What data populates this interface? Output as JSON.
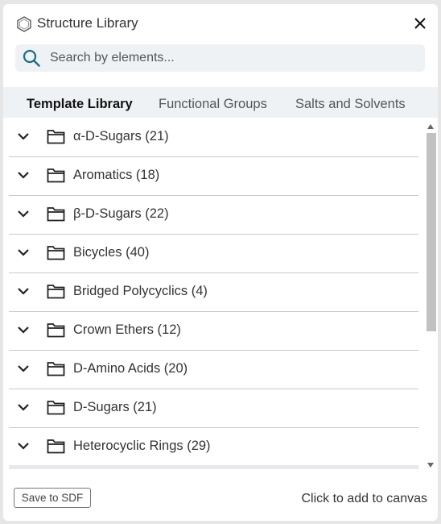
{
  "header": {
    "title": "Structure Library",
    "logo_icon": "hexagon-icon",
    "close_icon": "close-icon"
  },
  "search": {
    "placeholder": "Search by elements...",
    "value": ""
  },
  "tabs": [
    {
      "label": "Template Library",
      "active": true
    },
    {
      "label": "Functional Groups",
      "active": false
    },
    {
      "label": "Salts and Solvents",
      "active": false
    }
  ],
  "groups": [
    {
      "label": "α-D-Sugars (21)"
    },
    {
      "label": "Aromatics (18)"
    },
    {
      "label": "β-D-Sugars (22)"
    },
    {
      "label": "Bicycles (40)"
    },
    {
      "label": "Bridged Polycyclics (4)"
    },
    {
      "label": "Crown Ethers (12)"
    },
    {
      "label": "D-Amino Acids (20)"
    },
    {
      "label": "D-Sugars (21)"
    },
    {
      "label": "Heterocyclic Rings (29)"
    }
  ],
  "footer": {
    "save_label": "Save to SDF",
    "hint": "Click to add to canvas"
  },
  "colors": {
    "accent": "#1f6f86",
    "tab_background": "#eff2f5",
    "divider": "#c9c9c9"
  }
}
